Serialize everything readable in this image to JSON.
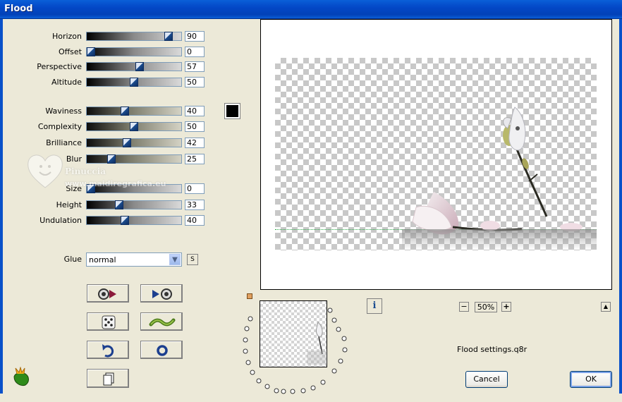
{
  "window": {
    "title": "Flood"
  },
  "sliders": [
    {
      "label": "Horizon",
      "value": "90",
      "level": 0.9
    },
    {
      "label": "Offset",
      "value": "0",
      "level": 0.0
    },
    {
      "label": "Perspective",
      "value": "57",
      "level": 0.57
    },
    {
      "label": "Altitude",
      "value": "50",
      "level": 0.5
    },
    {
      "label": "Waviness",
      "value": "40",
      "level": 0.4
    },
    {
      "label": "Complexity",
      "value": "50",
      "level": 0.5
    },
    {
      "label": "Brilliance",
      "value": "42",
      "level": 0.42
    },
    {
      "label": "Blur",
      "value": "25",
      "level": 0.25
    },
    {
      "label": "Size",
      "value": "0",
      "level": 0.0
    },
    {
      "label": "Height",
      "value": "33",
      "level": 0.33
    },
    {
      "label": "Undulation",
      "value": "40",
      "level": 0.4
    }
  ],
  "swatch": {
    "color": "#000000"
  },
  "glue": {
    "label": "Glue",
    "value": "normal",
    "s_button": "S"
  },
  "tool_buttons": [
    "play-record-icon",
    "record-play-icon",
    "dice-icon",
    "wave-icon",
    "undo-icon",
    "circle-icon",
    "copy-page-icon"
  ],
  "preview": {
    "zoom": "50%",
    "settings_file": "Flood settings.q8r"
  },
  "watermark": {
    "line1": "Pinuccia",
    "line2": "www.maidiregrafica.eu"
  },
  "buttons": {
    "cancel": "Cancel",
    "ok": "OK"
  }
}
